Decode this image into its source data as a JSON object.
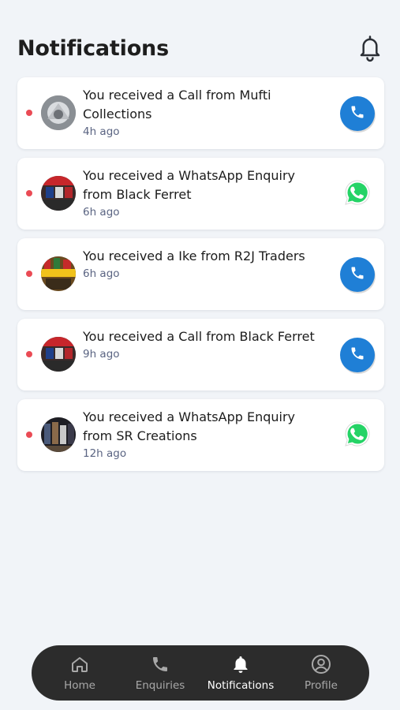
{
  "header": {
    "title": "Notifications",
    "bell_icon": "bell-icon"
  },
  "notifications": [
    {
      "message": "You received a Call from Mufti Collections",
      "time": "4h ago",
      "type": "call",
      "icon": "phone-icon",
      "unread": true
    },
    {
      "message": "You received a WhatsApp Enquiry from Black Ferret",
      "time": "6h ago",
      "type": "whatsapp",
      "icon": "whatsapp-icon",
      "unread": true
    },
    {
      "message": "You received a Ike from R2J Traders",
      "time": "6h ago",
      "type": "call",
      "icon": "phone-icon",
      "unread": true
    },
    {
      "message": "You received a Call from Black Ferret",
      "time": "9h ago",
      "type": "call",
      "icon": "phone-icon",
      "unread": true
    },
    {
      "message": "You received a WhatsApp Enquiry from SR Creations",
      "time": "12h ago",
      "type": "whatsapp",
      "icon": "whatsapp-icon",
      "unread": true
    }
  ],
  "bottom_nav": {
    "items": [
      {
        "label": "Home",
        "icon": "home-icon",
        "active": false
      },
      {
        "label": "Enquiries",
        "icon": "phone-icon",
        "active": false
      },
      {
        "label": "Notifications",
        "icon": "bell-icon",
        "active": true
      },
      {
        "label": "Profile",
        "icon": "profile-icon",
        "active": false
      }
    ]
  },
  "colors": {
    "background": "#f1f4f8",
    "unread_dot": "#ea4b55",
    "call_button": "#1f7fd6",
    "whatsapp": "#25d366",
    "nav_background": "#2c2c2c",
    "time_text": "#5a6482"
  }
}
